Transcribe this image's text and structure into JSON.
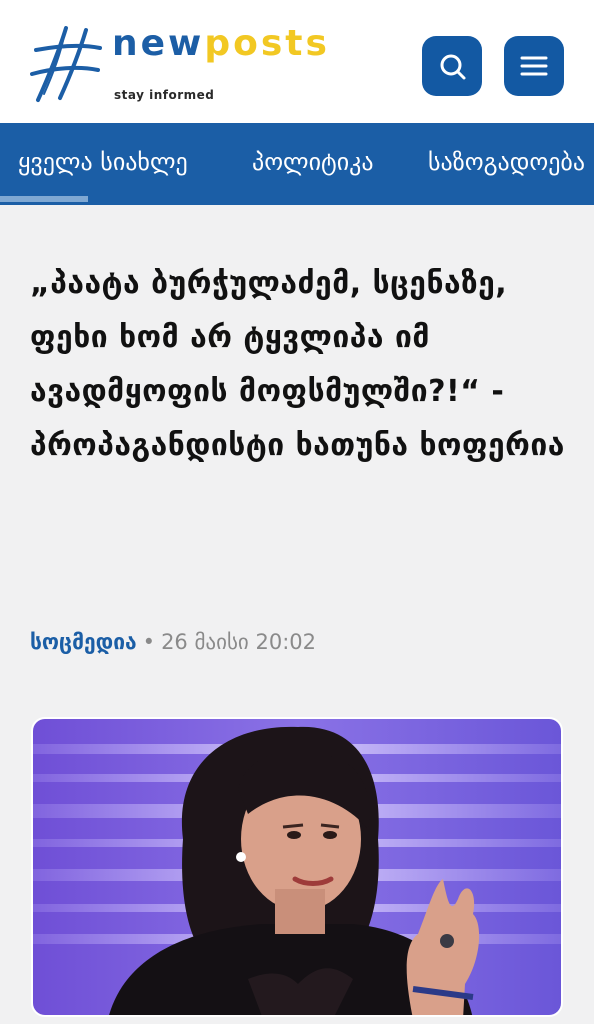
{
  "header": {
    "logo_word_part1": "new",
    "logo_word_part2": "posts",
    "tagline": "stay informed",
    "search_icon": "search-icon",
    "menu_icon": "hamburger-menu-icon",
    "colors": {
      "brand_blue": "#1b5ea6",
      "brand_yellow": "#f2c823"
    }
  },
  "nav": {
    "items": [
      "ყველა სიახლე",
      "პოლიტიკა",
      "საზოგადოება"
    ]
  },
  "article": {
    "title": "„პაატა ბურჭულაძემ, სცენაზე, ფეხი ხომ არ ტყვლიპა იმ ავადმყოფის მოფსმულში?!“ - პროპაგანდისტი ხათუნა ხოფერია",
    "author": "სოცმედია",
    "separator": "•",
    "date": "26 მაისი 20:02"
  }
}
